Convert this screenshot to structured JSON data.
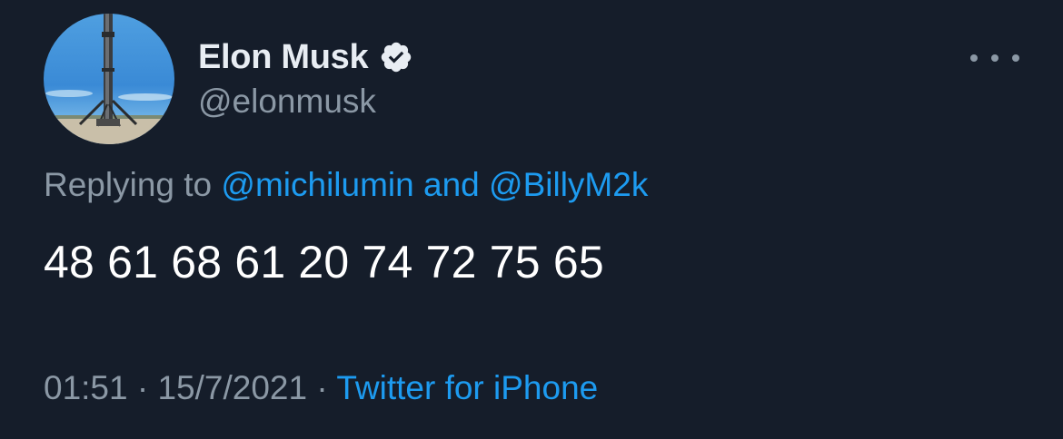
{
  "author": {
    "name": "Elon Musk",
    "handle": "@elonmusk",
    "avatar_icon": "rocket-booster-avatar-icon",
    "verified_icon": "verified-badge-icon"
  },
  "reply": {
    "prefix": "Replying to",
    "mention_1": "@michilumin",
    "joiner": "and",
    "mention_2": "@BillyM2k"
  },
  "tweet": {
    "text": "48 61 68 61 20 74 72 75 65"
  },
  "meta": {
    "time": "01:51",
    "separator": "·",
    "date": "15/7/2021",
    "source": "Twitter for iPhone"
  },
  "menu": {
    "icon": "more-options-icon"
  },
  "colors": {
    "background": "#151d2a",
    "text_primary": "#ffffff",
    "text_secondary": "#8b98a5",
    "link": "#1d9bf0"
  }
}
